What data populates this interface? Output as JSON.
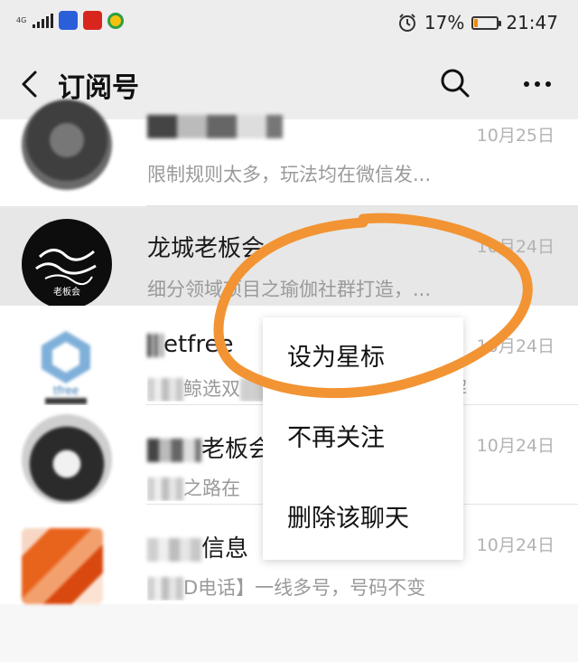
{
  "status_bar": {
    "network_label": "4G",
    "battery_percent": "17%",
    "battery_level": 0.17,
    "time": "21:47",
    "icons": [
      "signal-icon",
      "app-badge-icon",
      "app-badge-icon",
      "app-badge-icon",
      "alarm-icon",
      "battery-icon"
    ]
  },
  "nav": {
    "title": "订阅号",
    "icons": [
      "back-icon",
      "search-icon",
      "more-icon"
    ]
  },
  "items": [
    {
      "name": "",
      "date": "10月25日",
      "preview": "限制规则太多，玩法均在微信发..."
    },
    {
      "name": "龙城老板会",
      "date": "10月24日",
      "preview": "细分领域项目之瑜伽社群打造，..."
    },
    {
      "name": "etfree",
      "date": "10月24日",
      "preview_mid": "鲸选双",
      "preview_end": "解"
    },
    {
      "name": "老板会",
      "date": "10月24日",
      "preview": "之路在"
    },
    {
      "name": "信息",
      "date": "10月24日",
      "preview": "D电话】一线多号，号码不变"
    }
  ],
  "avatar_texts": {
    "longcheng": "老板会",
    "etfree": "tfree"
  },
  "context_menu": {
    "items": [
      "设为星标",
      "不再关注",
      "删除该聊天"
    ]
  },
  "colors": {
    "annotation": "#f29433",
    "pressed_row": "#e7e7e7",
    "battery": "#f08a00"
  }
}
